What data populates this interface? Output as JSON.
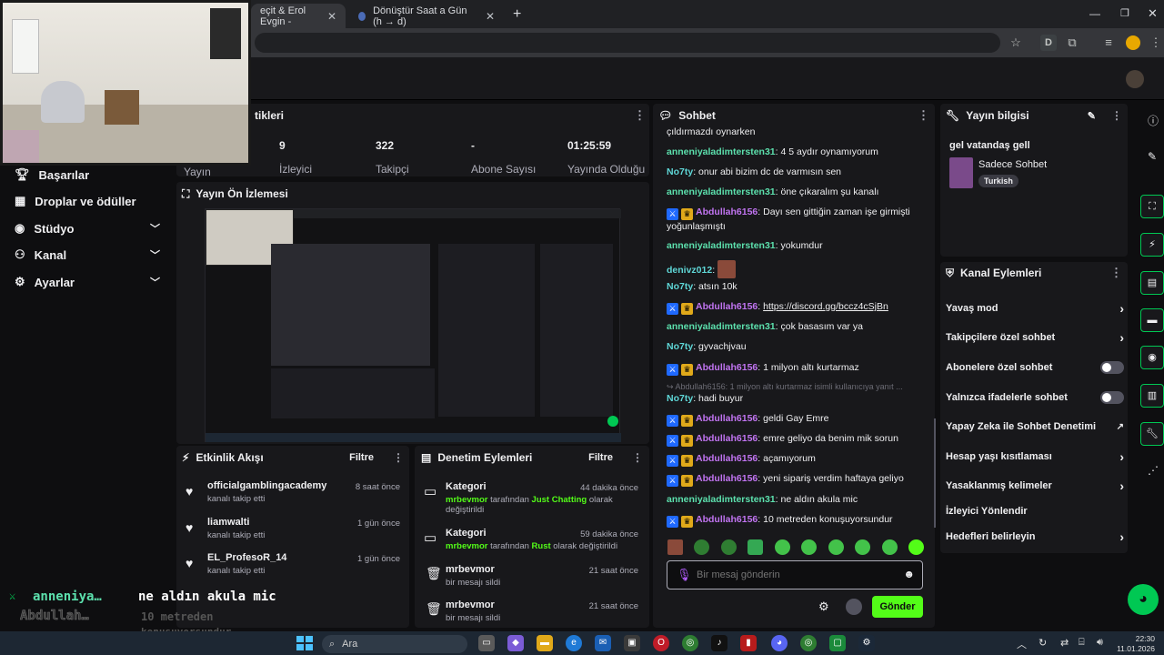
{
  "browser": {
    "tabs": [
      {
        "label": "eçit & Erol Evgin -"
      },
      {
        "label": "Dönüştür Saat a Gün (h → d)"
      }
    ],
    "new_tab": "+",
    "profile_letter": "D"
  },
  "sidebar": {
    "items": [
      {
        "label": "Başarılar",
        "icon": "trophy-icon"
      },
      {
        "label": "Droplar ve ödüller",
        "icon": "gift-icon"
      },
      {
        "label": "Stüdyo",
        "icon": "studio-icon"
      },
      {
        "label": "Kanal",
        "icon": "channel-icon"
      },
      {
        "label": "Ayarlar",
        "icon": "gear-icon"
      }
    ]
  },
  "stats": {
    "title": "tikleri",
    "partial_label": "Yayın",
    "items": [
      {
        "value": "9",
        "label": "İzleyici"
      },
      {
        "value": "322",
        "label": "Takipçi"
      },
      {
        "value": "-",
        "label": "Abone Sayısı"
      },
      {
        "value": "01:25:59",
        "label": "Yayında Olduğu"
      }
    ]
  },
  "preview": {
    "title": "Yayın Ön İzlemesi"
  },
  "activity": {
    "title": "Etkinlik Akışı",
    "filter": "Filtre",
    "items": [
      {
        "user": "officialgamblingacademy",
        "sub": "kanalı takip etti",
        "time": "8 saat önce"
      },
      {
        "user": "liamwalti",
        "sub": "kanalı takip etti",
        "time": "1 gün önce"
      },
      {
        "user": "EL_ProfesoR_14",
        "sub": "kanalı takip etti",
        "time": "1 gün önce"
      }
    ]
  },
  "moderation": {
    "title": "Denetim Eylemleri",
    "filter": "Filtre",
    "items": [
      {
        "title": "Kategori",
        "actor": "mrbevmor",
        "pre": " tarafından ",
        "hl": "Just Chatting",
        "post": " olarak değiştirildi",
        "time": "44 dakika önce"
      },
      {
        "title": "Kategori",
        "actor": "mrbevmor",
        "pre": " tarafından ",
        "hl": "Rust",
        "post": " olarak değiştirildi",
        "time": "59 dakika önce"
      },
      {
        "title": "mrbevmor",
        "actor": "",
        "pre": "bir mesajı sildi",
        "hl": "",
        "post": "",
        "time": "21 saat önce"
      },
      {
        "title": "mrbevmor",
        "actor": "",
        "pre": "bir mesajı sildi",
        "hl": "",
        "post": "",
        "time": "21 saat önce"
      }
    ]
  },
  "chat": {
    "title": "Sohbet",
    "lines": [
      {
        "user": "",
        "text": "çıldırmazdı oynarken",
        "cls": "",
        "badges": false
      },
      {
        "user": "anneniyaladimtersten31",
        "text": "4 5 aydır oynamıyorum",
        "cls": "uname-g",
        "badges": false
      },
      {
        "user": "No7ty",
        "text": "onur abi bizim dc de varmısın sen",
        "cls": "uname-c",
        "badges": false
      },
      {
        "user": "anneniyaladimtersten31",
        "text": "öne çıkaralım şu kanalı",
        "cls": "uname-g",
        "badges": false
      },
      {
        "user": "Abdullah6156",
        "text": "Dayı sen gittiğin zaman işe girmişti yoğunlaşmıştı",
        "cls": "uname-p",
        "badges": true
      },
      {
        "user": "anneniyaladimtersten31",
        "text": "yokumdur",
        "cls": "uname-g",
        "badges": false
      },
      {
        "user": "denivz012",
        "text": "",
        "cls": "uname-c",
        "badges": false
      },
      {
        "user": "No7ty",
        "text": "atsın 10k",
        "cls": "uname-c",
        "badges": false
      },
      {
        "user": "Abdullah6156",
        "text": "https://discord.gg/bccz4cSjBn",
        "cls": "uname-p",
        "badges": true
      },
      {
        "user": "anneniyaladimtersten31",
        "text": "çok basasım var ya",
        "cls": "uname-g",
        "badges": false
      },
      {
        "user": "No7ty",
        "text": "gyvachjvau",
        "cls": "uname-c",
        "badges": false
      },
      {
        "user": "Abdullah6156",
        "text": "1 milyon altı kurtarmaz",
        "cls": "uname-p",
        "badges": true
      },
      {
        "user": "",
        "text": "↪ Abdullah6156: 1 milyon altı kurtarmaz isimli kullanıcıya yanıt ...",
        "cls": "",
        "badges": false
      },
      {
        "user": "No7ty",
        "text": "hadi buyur",
        "cls": "uname-c",
        "badges": false
      },
      {
        "user": "Abdullah6156",
        "text": "geldi Gay Emre",
        "cls": "uname-p",
        "badges": true
      },
      {
        "user": "Abdullah6156",
        "text": "emre geliyo da benim mik sorun",
        "cls": "uname-p",
        "badges": true
      },
      {
        "user": "Abdullah6156",
        "text": "açamıyorum",
        "cls": "uname-p",
        "badges": true
      },
      {
        "user": "Abdullah6156",
        "text": "yeni sipariş verdim haftaya geliyo",
        "cls": "uname-p",
        "badges": true
      },
      {
        "user": "anneniyaladimtersten31",
        "text": "ne aldın akula mic",
        "cls": "uname-g",
        "badges": false
      },
      {
        "user": "Abdullah6156",
        "text": "10 metreden konuşuyorsundur",
        "cls": "uname-p",
        "badges": true
      }
    ],
    "input_placeholder": "Bir mesaj gönderin",
    "send_label": "Gönder"
  },
  "stream_info": {
    "title": "Yayın bilgisi",
    "stream_title": "gel vatandaş gell",
    "category": "Sadece Sohbet",
    "tag": "Turkish"
  },
  "channel_actions": {
    "title": "Kanal Eylemleri",
    "items": [
      {
        "label": "Yavaş mod",
        "kind": "arrow"
      },
      {
        "label": "Takipçilere özel sohbet",
        "kind": "arrow"
      },
      {
        "label": "Abonelere özel sohbet",
        "kind": "toggle"
      },
      {
        "label": "Yalnızca ifadelerle sohbet",
        "kind": "toggle"
      },
      {
        "label": "Yapay Zeka ile Sohbet Denetimi",
        "kind": "ext"
      },
      {
        "label": "Hesap yaşı kısıtlaması",
        "kind": "arrow"
      },
      {
        "label": "Yasaklanmış kelimeler",
        "kind": "arrow"
      },
      {
        "label": "İzleyici Yönlendir",
        "kind": "none"
      },
      {
        "label": "Hedefleri belirleyin",
        "kind": "arrow"
      }
    ]
  },
  "overlay": {
    "line1_user": "anneniya…",
    "line1_text": "ne aldın akula mic",
    "line2_user": "Abdullah…",
    "line2_text_a": "10 metreden",
    "line2_text_b": "konuşuyorsundur"
  },
  "taskbar": {
    "search": "Ara",
    "time": "22:30",
    "date": "11.01.2026"
  },
  "colors": {
    "accent": "#53fc18",
    "panel": "#18181b",
    "background": "#0e0e10"
  }
}
